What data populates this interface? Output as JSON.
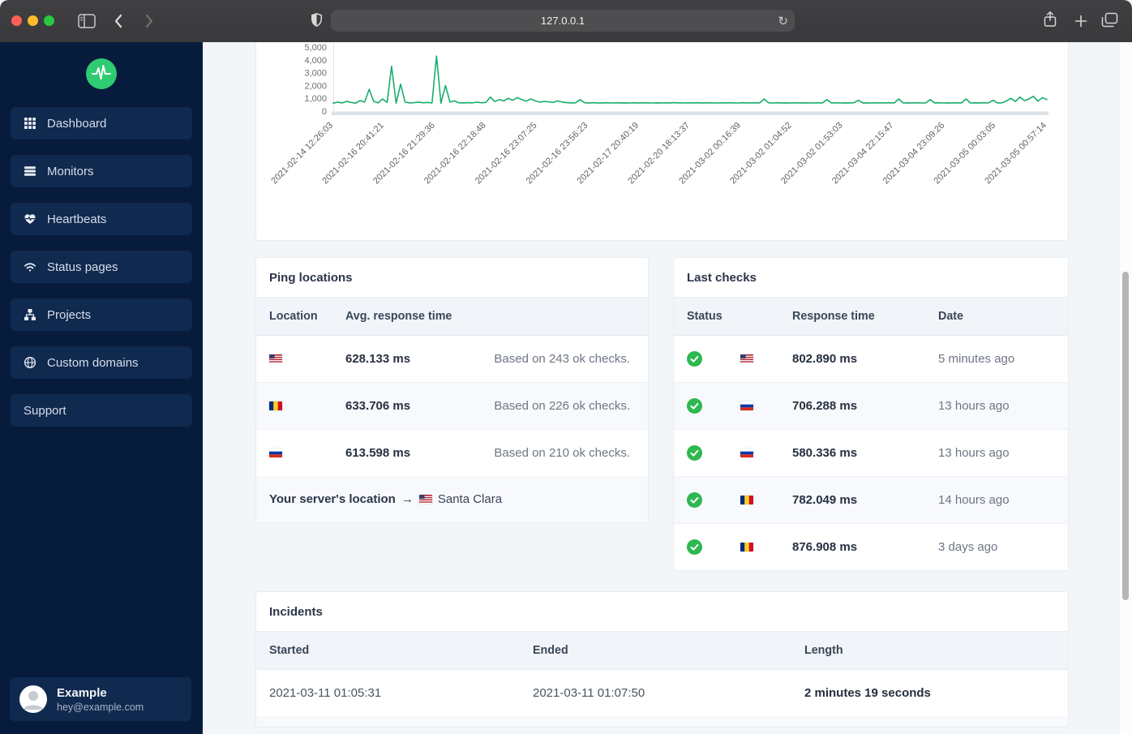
{
  "browser": {
    "url": "127.0.0.1",
    "reload_glyph": "↻"
  },
  "sidebar": {
    "items": [
      {
        "label": "Dashboard",
        "icon": "grid-icon"
      },
      {
        "label": "Monitors",
        "icon": "list-icon"
      },
      {
        "label": "Heartbeats",
        "icon": "heart-pulse-icon"
      },
      {
        "label": "Status pages",
        "icon": "wifi-icon"
      },
      {
        "label": "Projects",
        "icon": "sitemap-icon"
      },
      {
        "label": "Custom domains",
        "icon": "globe-icon"
      },
      {
        "label": "Support",
        "icon": null
      }
    ],
    "user": {
      "name": "Example",
      "email": "hey@example.com"
    }
  },
  "chart_data": {
    "type": "line",
    "ylabel": "",
    "xlabel": "",
    "ylim": [
      0,
      5000
    ],
    "yticks": [
      0,
      1000,
      2000,
      3000,
      4000,
      5000
    ],
    "ytick_labels": [
      "0",
      "1,000",
      "2,000",
      "3,000",
      "4,000",
      "5,000"
    ],
    "x_tick_labels": [
      "2021-02-14 12:26:03",
      "2021-02-16 20:41:21",
      "2021-02-16 21:29:36",
      "2021-02-16 22:18:48",
      "2021-02-16 23:07:25",
      "2021-02-16 23:56:23",
      "2021-02-17 20:40:19",
      "2021-02-20 18:13:37",
      "2021-03-02 00:16:39",
      "2021-03-02 01:04:52",
      "2021-03-02 01:53:03",
      "2021-03-04 22:15:47",
      "2021-03-04 23:09:26",
      "2021-03-05 00:03:05",
      "2021-03-05 00:57:14"
    ],
    "grid": false,
    "legend": false,
    "series": [
      {
        "name": "response-time-ms",
        "color": "#17ad6d",
        "values": [
          620,
          700,
          640,
          760,
          680,
          620,
          820,
          700,
          1700,
          760,
          640,
          950,
          680,
          3500,
          620,
          2100,
          700,
          640,
          660,
          700,
          650,
          680,
          640,
          4300,
          620,
          2000,
          700,
          800,
          650,
          640,
          660,
          640,
          700,
          650,
          680,
          1100,
          750,
          900,
          800,
          1000,
          850,
          1050,
          900,
          780,
          950,
          800,
          700,
          760,
          720,
          680,
          800,
          700,
          660,
          640,
          650,
          900,
          650,
          640,
          660,
          640,
          640,
          650,
          635,
          655,
          640,
          645,
          635,
          650,
          640,
          645,
          650,
          635,
          645,
          640,
          650,
          640,
          660,
          645,
          635,
          650,
          640,
          655,
          640,
          645,
          650,
          635,
          645,
          640,
          650,
          645,
          635,
          650,
          640,
          645,
          655,
          640,
          950,
          645,
          635,
          650,
          640,
          645,
          635,
          655,
          640,
          645,
          640,
          635,
          650,
          640,
          900,
          640,
          650,
          635,
          645,
          640,
          650,
          850,
          640,
          645,
          635,
          650,
          640,
          645,
          655,
          640,
          950,
          635,
          645,
          640,
          650,
          635,
          645,
          900,
          640,
          650,
          635,
          645,
          640,
          655,
          640,
          950,
          635,
          645,
          640,
          650,
          635,
          850,
          640,
          645,
          800,
          1000,
          750,
          1100,
          820,
          950,
          1150,
          780,
          1050,
          900
        ]
      }
    ]
  },
  "ping_locations": {
    "title": "Ping locations",
    "columns": [
      "Location",
      "Avg. response time"
    ],
    "rows": [
      {
        "flag": "us",
        "avg": "628.133 ms",
        "note": "Based on 243 ok checks."
      },
      {
        "flag": "ro",
        "avg": "633.706 ms",
        "note": "Based on 226 ok checks."
      },
      {
        "flag": "ru",
        "avg": "613.598 ms",
        "note": "Based on 210 ok checks."
      }
    ],
    "footer": {
      "label": "Your server's location",
      "arrow": "→",
      "flag": "us",
      "value": "Santa Clara"
    }
  },
  "last_checks": {
    "title": "Last checks",
    "columns": [
      "Status",
      "Response time",
      "Date"
    ],
    "rows": [
      {
        "status": "ok",
        "flag": "us",
        "response": "802.890 ms",
        "date": "5 minutes ago"
      },
      {
        "status": "ok",
        "flag": "ru",
        "response": "706.288 ms",
        "date": "13 hours ago"
      },
      {
        "status": "ok",
        "flag": "ru",
        "response": "580.336 ms",
        "date": "13 hours ago"
      },
      {
        "status": "ok",
        "flag": "ro",
        "response": "782.049 ms",
        "date": "14 hours ago"
      },
      {
        "status": "ok",
        "flag": "ro",
        "response": "876.908 ms",
        "date": "3 days ago"
      }
    ]
  },
  "incidents": {
    "title": "Incidents",
    "columns": [
      "Started",
      "Ended",
      "Length"
    ],
    "rows": [
      {
        "started": "2021-03-11 01:05:31",
        "ended": "2021-03-11 01:07:50",
        "length": "2 minutes 19 seconds"
      }
    ]
  },
  "colors": {
    "chart_line": "#17ad6d",
    "logo_green": "#2ecb72",
    "status_ok": "#2eb850",
    "sidebar_bg": "#071b3c",
    "sidebar_item_bg": "#10294e",
    "flags": {
      "us": {
        "red": "#b22234",
        "blue": "#3c3b6e",
        "white": "#ffffff"
      },
      "ro": {
        "blue": "#002b7f",
        "yellow": "#fcd116",
        "red": "#ce1126"
      },
      "ru": {
        "white": "#ffffff",
        "blue": "#0039a6",
        "red": "#d52b1e"
      }
    }
  }
}
